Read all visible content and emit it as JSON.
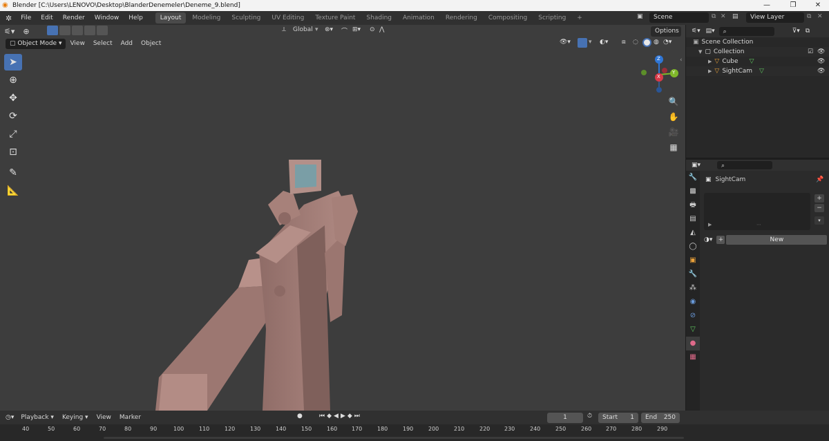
{
  "window": {
    "title": "Blender [C:\\Users\\LENOVO\\Desktop\\BlanderDenemeler\\Deneme_9.blend]",
    "controls": [
      "—",
      "❐",
      "✕"
    ]
  },
  "menu": [
    "File",
    "Edit",
    "Render",
    "Window",
    "Help"
  ],
  "workspaces": [
    "Layout",
    "Modeling",
    "Sculpting",
    "UV Editing",
    "Texture Paint",
    "Shading",
    "Animation",
    "Rendering",
    "Compositing",
    "Scripting"
  ],
  "active_workspace": "Layout",
  "scene": {
    "name": "Scene",
    "view_layer": "View Layer"
  },
  "viewport": {
    "transform_orientation": "Global",
    "options_label": "Options",
    "mode": "Object Mode",
    "header_menu": [
      "View",
      "Select",
      "Add",
      "Object"
    ],
    "gizmo": {
      "x": "X",
      "y": "Y",
      "z": "Z"
    }
  },
  "outliner": {
    "root": "Scene Collection",
    "collection": "Collection",
    "items": [
      "Cube",
      "SightCam"
    ]
  },
  "properties": {
    "object_name": "SightCam",
    "new_button": "New"
  },
  "timeline": {
    "menu": [
      "Playback",
      "Keying",
      "View",
      "Marker"
    ],
    "current_frame": "1",
    "start_label": "Start",
    "start": "1",
    "end_label": "End",
    "end": "250",
    "ticks": [
      "40",
      "50",
      "60",
      "70",
      "80",
      "90",
      "100",
      "110",
      "120",
      "130",
      "140",
      "150",
      "160",
      "170",
      "180",
      "190",
      "200",
      "210",
      "220",
      "230",
      "240",
      "250",
      "260",
      "270",
      "280",
      "290"
    ]
  },
  "colors": {
    "accent": "#4772b3",
    "model": "#a8807a",
    "viewport_bg": "#3d3d3d"
  }
}
